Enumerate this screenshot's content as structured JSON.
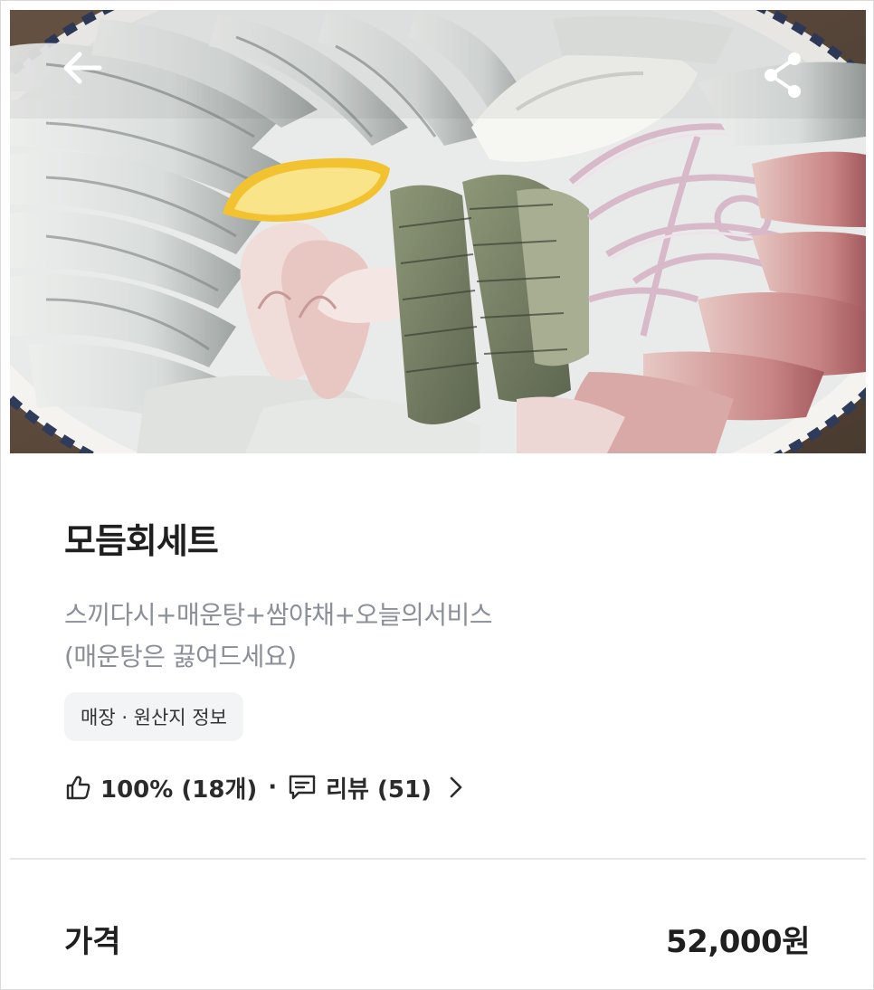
{
  "menu": {
    "title": "모듬회세트",
    "description_lines": [
      "스끼다시+매운탕+쌈야채+오늘의서비스",
      "(매운탕은 끓여드세요)"
    ],
    "info_chip": "매장 · 원산지 정보",
    "rating": "100% (18개)",
    "separator": "·",
    "review": "리뷰 (51)"
  },
  "price": {
    "label": "가격",
    "value": "52,000원"
  },
  "icons": {
    "back": "arrow-left-icon",
    "share": "share-icon",
    "like": "thumbs-up-icon",
    "review": "chat-bubble-icon",
    "more": "chevron-right-icon"
  },
  "colors": {
    "title": "#1f1f1f",
    "description": "#8a8f99",
    "chip_bg": "#f3f4f6",
    "divider": "#e6e7ea"
  }
}
